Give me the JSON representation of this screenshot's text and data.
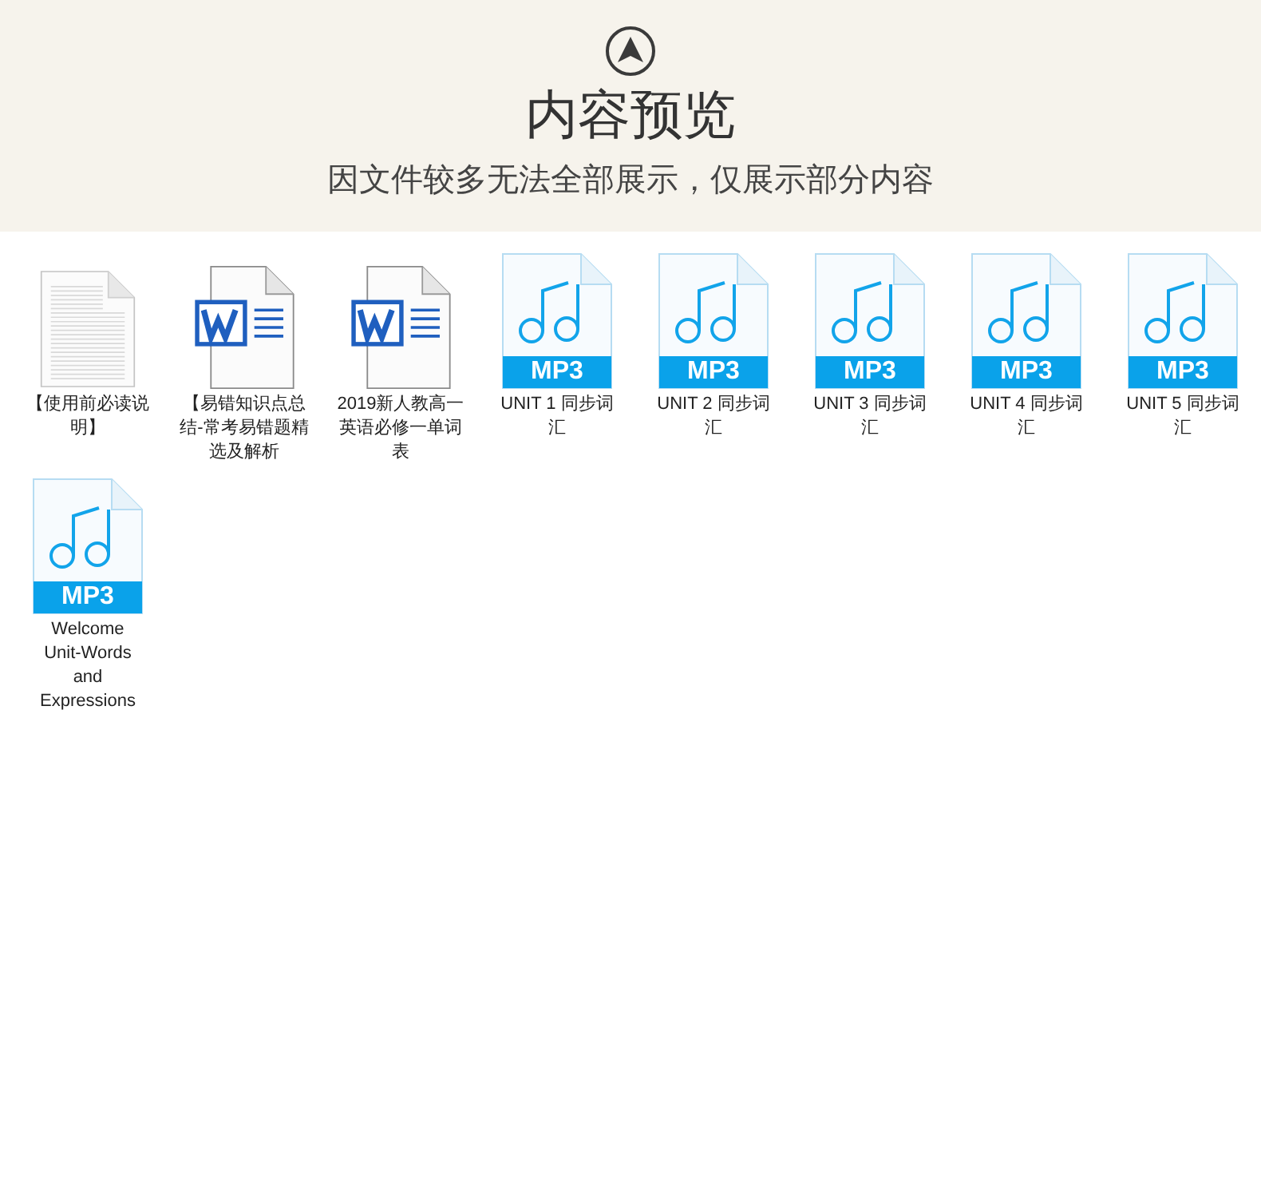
{
  "header": {
    "title": "内容预览",
    "subtitle": "因文件较多无法全部展示，仅展示部分内容"
  },
  "files": [
    {
      "kind": "text",
      "lines": [
        "【使用前必读说",
        "明】"
      ]
    },
    {
      "kind": "word",
      "lines": [
        "【易错知识点总",
        "结-常考易错题精",
        "选及解析"
      ]
    },
    {
      "kind": "word",
      "lines": [
        "2019新人教高一",
        "英语必修一单词",
        "表"
      ]
    },
    {
      "kind": "mp3",
      "badge": "MP3",
      "lines": [
        "UNIT 1 同步词",
        "汇"
      ]
    },
    {
      "kind": "mp3",
      "badge": "MP3",
      "lines": [
        "UNIT 2 同步词",
        "汇"
      ]
    },
    {
      "kind": "mp3",
      "badge": "MP3",
      "lines": [
        "UNIT 3 同步词",
        "汇"
      ]
    },
    {
      "kind": "mp3",
      "badge": "MP3",
      "lines": [
        "UNIT 4 同步词",
        "汇"
      ]
    },
    {
      "kind": "mp3",
      "badge": "MP3",
      "lines": [
        "UNIT 5 同步词",
        "汇"
      ]
    },
    {
      "kind": "mp3",
      "badge": "MP3",
      "lines": [
        "Welcome",
        "Unit-Words",
        "and",
        "Expressions"
      ]
    }
  ]
}
